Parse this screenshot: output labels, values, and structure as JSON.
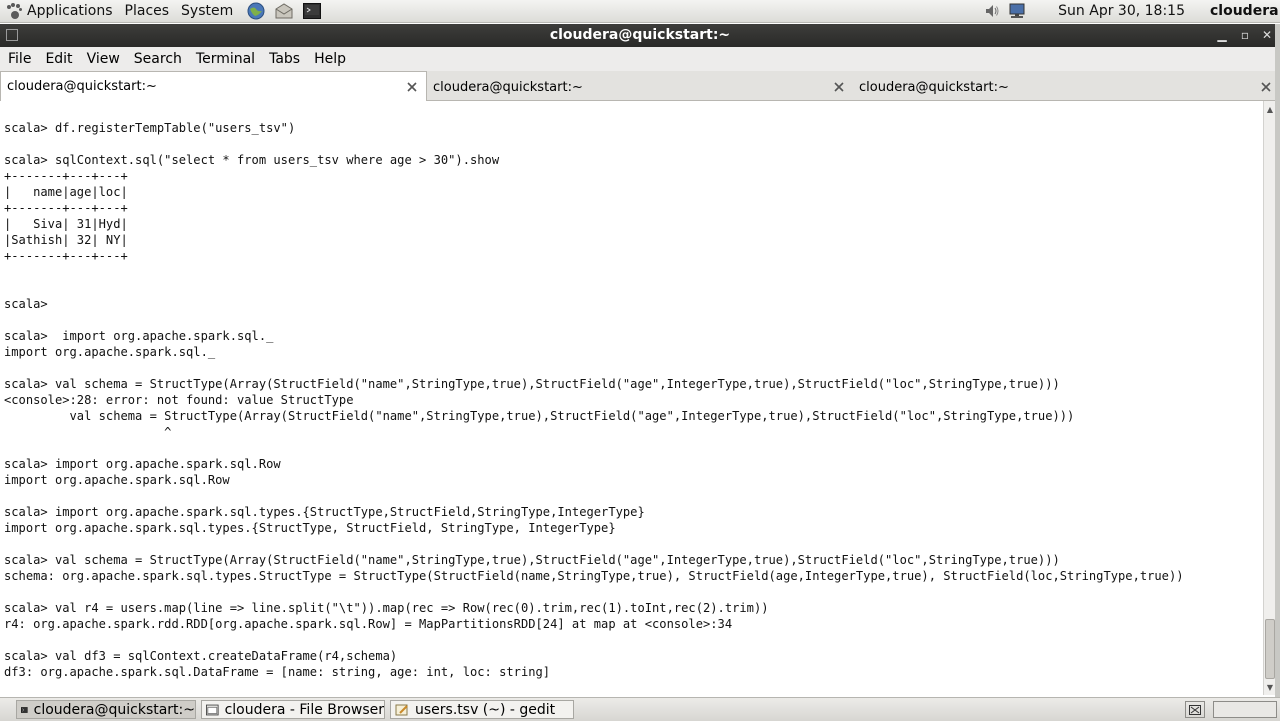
{
  "top_panel": {
    "menus": [
      "Applications",
      "Places",
      "System"
    ],
    "clock": "Sun Apr 30, 18:15",
    "user": "cloudera"
  },
  "window": {
    "title": "cloudera@quickstart:~"
  },
  "menubar": [
    "File",
    "Edit",
    "View",
    "Search",
    "Terminal",
    "Tabs",
    "Help"
  ],
  "tabs": [
    {
      "label": "cloudera@quickstart:~",
      "active": true
    },
    {
      "label": "cloudera@quickstart:~",
      "active": false
    },
    {
      "label": "cloudera@quickstart:~",
      "active": false
    }
  ],
  "terminal": {
    "text": "\nscala> df.registerTempTable(\"users_tsv\")\n\nscala> sqlContext.sql(\"select * from users_tsv where age > 30\").show\n+-------+---+---+\n|   name|age|loc|\n+-------+---+---+\n|   Siva| 31|Hyd|\n|Sathish| 32| NY|\n+-------+---+---+\n\n\nscala>\n\nscala>  import org.apache.spark.sql._\nimport org.apache.spark.sql._\n\nscala> val schema = StructType(Array(StructField(\"name\",StringType,true),StructField(\"age\",IntegerType,true),StructField(\"loc\",StringType,true)))\n<console>:28: error: not found: value StructType\n         val schema = StructType(Array(StructField(\"name\",StringType,true),StructField(\"age\",IntegerType,true),StructField(\"loc\",StringType,true)))\n                      ^\n\nscala> import org.apache.spark.sql.Row\nimport org.apache.spark.sql.Row\n\nscala> import org.apache.spark.sql.types.{StructType,StructField,StringType,IntegerType}\nimport org.apache.spark.sql.types.{StructType, StructField, StringType, IntegerType}\n\nscala> val schema = StructType(Array(StructField(\"name\",StringType,true),StructField(\"age\",IntegerType,true),StructField(\"loc\",StringType,true)))\nschema: org.apache.spark.sql.types.StructType = StructType(StructField(name,StringType,true), StructField(age,IntegerType,true), StructField(loc,StringType,true))\n\nscala> val r4 = users.map(line => line.split(\"\\t\")).map(rec => Row(rec(0).trim,rec(1).toInt,rec(2).trim))\nr4: org.apache.spark.rdd.RDD[org.apache.spark.sql.Row] = MapPartitionsRDD[24] at map at <console>:34\n\nscala> val df3 = sqlContext.createDataFrame(r4,schema)\ndf3: org.apache.spark.sql.DataFrame = [name: string, age: int, loc: string]"
  },
  "taskbar": {
    "items": [
      {
        "label": "cloudera@quickstart:~",
        "icon": "terminal-icon",
        "active": true
      },
      {
        "label": "cloudera - File Browser",
        "icon": "folder-icon",
        "active": false
      },
      {
        "label": "users.tsv (~) - gedit",
        "icon": "text-editor-icon",
        "active": false
      }
    ]
  },
  "colors": {
    "titlebar": "#2f2f2d",
    "panel": "#e8e8e4",
    "terminal_bg": "#ffffff",
    "terminal_fg": "#111111"
  }
}
